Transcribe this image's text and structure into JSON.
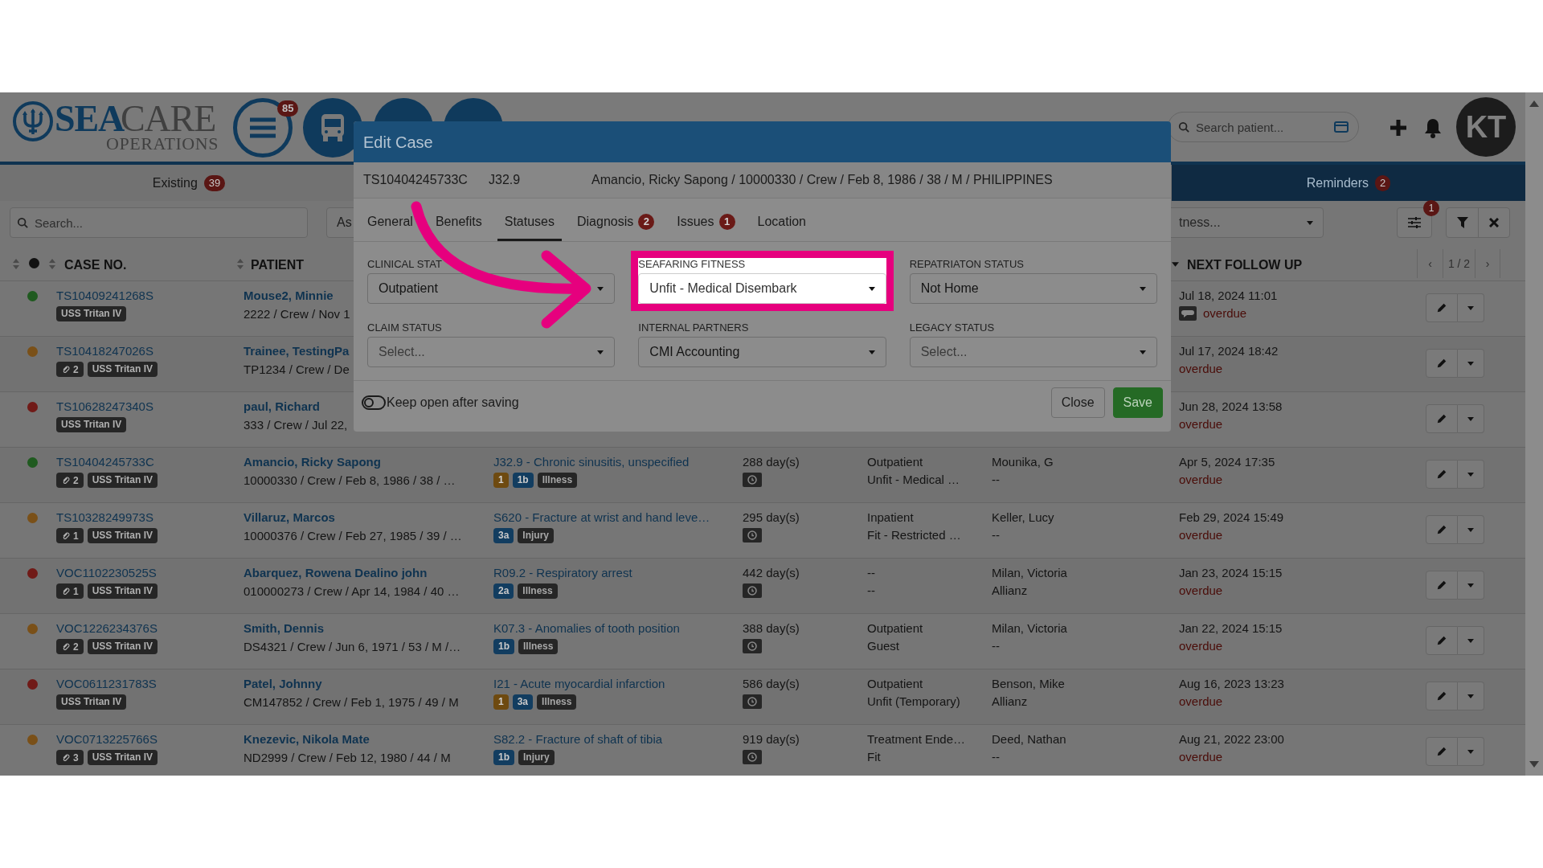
{
  "header": {
    "logo": {
      "sea": "SEA",
      "care": "CARE",
      "operations": "OPERATIONS"
    },
    "menu_badge": "85",
    "search": {
      "placeholder": "Search patient..."
    },
    "avatar": "KT"
  },
  "tabs": [
    {
      "label": "Existing",
      "count": "39",
      "selected": false
    },
    {
      "label": "Reminders",
      "count": "2",
      "selected": true
    }
  ],
  "filters": {
    "search": {
      "placeholder": "Search..."
    },
    "select_1": "As",
    "select_2": "tness...",
    "options_badge": "1"
  },
  "table": {
    "columns": [
      {
        "label": "CASE NO."
      },
      {
        "label": "PATIENT"
      },
      {
        "label": "NEXT FOLLOW UP"
      }
    ],
    "pagination": {
      "prev": "‹",
      "page": "1 / 2",
      "next": "›"
    },
    "rows": [
      {
        "color": "#1f5a1f",
        "case_no": "TS10409241268S",
        "attachments": null,
        "vessel": "USS Tritan IV",
        "patient": "Mouse2, Minnie",
        "details": "2222 / Crew / Nov 1",
        "follow_up": "Jul 18, 2024 11:01",
        "comment": true,
        "due": "overdue"
      },
      {
        "color": "#7a5018",
        "case_no": "TS10418247026S",
        "attachments": "2",
        "vessel": "USS Tritan IV",
        "patient": "Trainee, TestingPa",
        "details": "TP1234 / Crew / De",
        "follow_up": "Jul 17, 2024 18:42",
        "comment": false,
        "due": "overdue"
      },
      {
        "color": "#701a17",
        "case_no": "TS10628247340S",
        "attachments": null,
        "vessel": "USS Tritan IV",
        "patient": "paul, Richard",
        "details": "333 / Crew / Jul 22,",
        "follow_up": "Jun 28, 2024 13:58",
        "comment": false,
        "due": "overdue"
      },
      {
        "color": "#1f5a1f",
        "case_no": "TS10404245733C",
        "attachments": "2",
        "vessel": "USS Tritan IV",
        "patient": "Amancio, Ricky Sapong",
        "details": "10000330 / Crew / Feb 8, 1986 / 38 / …",
        "diagnosis": "J32.9 - Chronic sinusitis, unspecified",
        "diag_tags": [
          {
            "kind": "priority",
            "label": "1"
          },
          {
            "kind": "level",
            "label": "1b"
          },
          {
            "kind": "type",
            "label": "Illness"
          }
        ],
        "duration": "288 day(s)",
        "clinical": "Outpatient",
        "fitness": "Unfit - Medical …",
        "handler": "Mounika, G",
        "partner": "--",
        "follow_up": "Apr 5, 2024 17:35",
        "comment": false,
        "due": "overdue"
      },
      {
        "color": "#7a5018",
        "case_no": "TS10328249973S",
        "attachments": "1",
        "vessel": "USS Tritan IV",
        "patient": "Villaruz, Marcos",
        "details": "10000376 / Crew / Feb 27, 1985 / 39 / …",
        "diagnosis": "S620 - Fracture at wrist and hand leve…",
        "diag_tags": [
          {
            "kind": "level",
            "label": "3a"
          },
          {
            "kind": "type",
            "label": "Injury"
          }
        ],
        "duration": "295 day(s)",
        "clinical": "Inpatient",
        "fitness": "Fit - Restricted …",
        "handler": "Keller, Lucy",
        "partner": "--",
        "follow_up": "Feb 29, 2024 15:49",
        "comment": false,
        "due": "overdue"
      },
      {
        "color": "#701a17",
        "case_no": "VOC1102230525S",
        "attachments": "1",
        "vessel": "USS Tritan IV",
        "patient": "Abarquez, Rowena Dealino john",
        "details": "010000273 / Crew / Apr 14, 1984 / 40 …",
        "diagnosis": "R09.2 - Respiratory arrest",
        "diag_tags": [
          {
            "kind": "level",
            "label": "2a"
          },
          {
            "kind": "type",
            "label": "Illness"
          }
        ],
        "duration": "442 day(s)",
        "clinical": "--",
        "fitness": "--",
        "handler": "Milan, Victoria",
        "partner": "Allianz",
        "follow_up": "Jan 23, 2024 15:15",
        "comment": false,
        "due": "overdue"
      },
      {
        "color": "#7a5018",
        "case_no": "VOC1226234376S",
        "attachments": "2",
        "vessel": "USS Tritan IV",
        "patient": "Smith, Dennis",
        "details": "DS4321 / Crew / Jun 6, 1971 / 53 / M /…",
        "diagnosis": "K07.3 - Anomalies of tooth position",
        "diag_tags": [
          {
            "kind": "level",
            "label": "1b"
          },
          {
            "kind": "type",
            "label": "Illness"
          }
        ],
        "duration": "388 day(s)",
        "clinical": "Outpatient",
        "fitness": "Guest",
        "handler": "Milan, Victoria",
        "partner": "--",
        "follow_up": "Jan 22, 2024 15:15",
        "comment": false,
        "due": "overdue"
      },
      {
        "color": "#701a17",
        "case_no": "VOC0611231783S",
        "attachments": null,
        "vessel": "USS Tritan IV",
        "patient": "Patel, Johnny",
        "details": "CM147852 / Crew / Feb 1, 1975 / 49 / M",
        "diagnosis": "I21 - Acute myocardial infarction",
        "diag_tags": [
          {
            "kind": "priority",
            "label": "1"
          },
          {
            "kind": "level",
            "label": "3a"
          },
          {
            "kind": "type",
            "label": "Illness"
          }
        ],
        "duration": "586 day(s)",
        "clinical": "Outpatient",
        "fitness": "Unfit (Temporary)",
        "handler": "Benson, Mike",
        "partner": "Allianz",
        "follow_up": "Aug 16, 2023 13:23",
        "comment": false,
        "due": "overdue"
      },
      {
        "color": "#7a5018",
        "case_no": "VOC0713225766S",
        "attachments": "3",
        "vessel": "USS Tritan IV",
        "patient": "Knezevic, Nikola Mate",
        "details": "ND2999 / Crew / Feb 12, 1980 / 44 / M",
        "diagnosis": "S82.2 - Fracture of shaft of tibia",
        "diag_tags": [
          {
            "kind": "level",
            "label": "1b"
          },
          {
            "kind": "type",
            "label": "Injury"
          }
        ],
        "duration": "919 day(s)",
        "clinical": "Treatment Ende…",
        "fitness": "Fit",
        "handler": "Deed, Nathan",
        "partner": "--",
        "follow_up": "Aug 21, 2022 23:00",
        "comment": false,
        "due": "overdue"
      }
    ]
  },
  "modal": {
    "title": "Edit Case",
    "case_no": "TS10404245733C",
    "code": "J32.9",
    "patient": "Amancio, Ricky Sapong / 10000330 / Crew / Feb 8, 1986 / 38 / M / PHILIPPINES",
    "tabs": [
      {
        "label": "General",
        "selected": false
      },
      {
        "label": "Benefits",
        "selected": false
      },
      {
        "label": "Statuses",
        "selected": true
      },
      {
        "label": "Diagnosis",
        "badge": "2",
        "selected": false
      },
      {
        "label": "Issues",
        "badge": "1",
        "selected": false
      },
      {
        "label": "Location",
        "selected": false
      }
    ],
    "fields": [
      {
        "label": "CLINICAL STAT",
        "value": "Outpatient",
        "highlighted": false
      },
      {
        "label": "SEAFARING FITNESS",
        "value": "Unfit - Medical Disembark",
        "highlighted": true
      },
      {
        "label": "REPATRIATON STATUS",
        "value": "Not Home",
        "highlighted": false
      },
      {
        "label": "CLAIM STATUS",
        "placeholder": "Select...",
        "highlighted": false
      },
      {
        "label": "INTERNAL PARTNERS",
        "value": "CMI Accounting",
        "highlighted": false
      },
      {
        "label": "LEGACY STATUS",
        "placeholder": "Select...",
        "highlighted": false
      }
    ],
    "keep_open": {
      "label": "Keep open after saving",
      "on": false
    },
    "buttons": [
      {
        "kind": "default",
        "label": "Close"
      },
      {
        "kind": "primary",
        "label": "Save"
      }
    ]
  }
}
